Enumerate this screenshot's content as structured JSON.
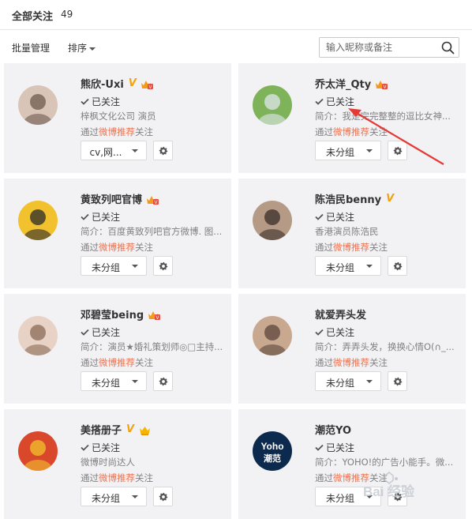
{
  "header": {
    "title": "全部关注",
    "count": "49"
  },
  "toolbar": {
    "batch_manage": "批量管理",
    "sort": "排序",
    "search_placeholder": "输入昵称或备注"
  },
  "cards": [
    {
      "name": "熊欣-Uxi",
      "verified": true,
      "vip": true,
      "vip_kind": "red",
      "status": "已关注",
      "desc": "梓枫文化公司 演员",
      "via_prefix": "通过",
      "via_link": "微博推荐",
      "via_suffix": "关注",
      "group": "cv,网...",
      "avatar_colors": [
        "#d9c4b8",
        "#6e5a4e"
      ]
    },
    {
      "name": "乔太洋_Qty",
      "verified": false,
      "vip": true,
      "vip_kind": "red",
      "status": "已关注",
      "desc": "简介：我是完完整整的逗比女神...",
      "via_prefix": "通过",
      "via_link": "微博推荐",
      "via_suffix": "关注",
      "group": "未分组",
      "avatar_colors": [
        "#7fb35a",
        "#dfe7ee"
      ]
    },
    {
      "name": "黄致列吧官博",
      "verified": false,
      "vip": true,
      "vip_kind": "red",
      "status": "已关注",
      "desc": "简介：百度黄致列吧官方微博. 图...",
      "via_prefix": "通过",
      "via_link": "微博推荐",
      "via_suffix": "关注",
      "group": "未分组",
      "avatar_colors": [
        "#f2c12e",
        "#2a2a2a"
      ]
    },
    {
      "name": "陈浩民benny",
      "verified": true,
      "vip": false,
      "vip_kind": "",
      "status": "已关注",
      "desc": "香港演员陈浩民",
      "via_prefix": "通过",
      "via_link": "微博推荐",
      "via_suffix": "关注",
      "group": "未分组",
      "avatar_colors": [
        "#b59a86",
        "#3a2e28"
      ]
    },
    {
      "name": "邓碧莹being",
      "verified": false,
      "vip": true,
      "vip_kind": "red",
      "status": "已关注",
      "desc": "简介：演员★婚礼策划师◎□主持...",
      "via_prefix": "通过",
      "via_link": "微博推荐",
      "via_suffix": "关注",
      "group": "未分组",
      "avatar_colors": [
        "#e8d2c6",
        "#8a6a55"
      ]
    },
    {
      "name": "就爱弄头发",
      "verified": false,
      "vip": false,
      "vip_kind": "",
      "status": "已关注",
      "desc": "简介：弄弄头发，换换心情O(∩_...",
      "via_prefix": "通过",
      "via_link": "微博推荐",
      "via_suffix": "关注",
      "group": "未分组",
      "avatar_colors": [
        "#c9a890",
        "#5b463b"
      ]
    },
    {
      "name": "美搭册子",
      "verified": true,
      "vip": true,
      "vip_kind": "gold",
      "status": "已关注",
      "desc": "微博时尚达人",
      "via_prefix": "通过",
      "via_link": "微博推荐",
      "via_suffix": "关注",
      "group": "未分组",
      "avatar_colors": [
        "#d9482b",
        "#f2c12e"
      ]
    },
    {
      "name": "潮范YO",
      "verified": false,
      "vip": false,
      "vip_kind": "",
      "status": "已关注",
      "desc": "简介：YOHO!的广告小能手。微...",
      "via_prefix": "通过",
      "via_link": "微博推荐",
      "via_suffix": "关注",
      "group": "未分组",
      "avatar_colors": [
        "#0c2a4e",
        "#ffffff"
      ],
      "avatar_text": "Yoho\n潮范"
    }
  ],
  "watermark": "Bai 经验"
}
